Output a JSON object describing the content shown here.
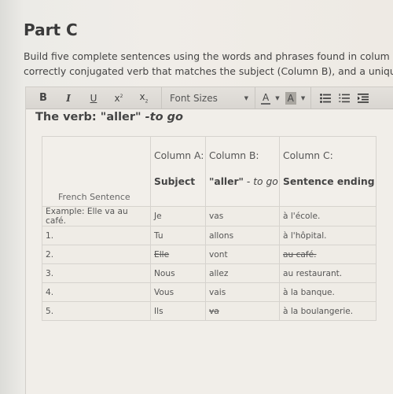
{
  "page": {
    "title": "Part C",
    "instructions_line1": "Build five complete sentences using the words and phrases found in colum",
    "instructions_line2": "correctly conjugated verb that matches the subject (Column B), and a uniqu"
  },
  "toolbar": {
    "bold": "B",
    "italic": "I",
    "underline": "U",
    "superscript_base": "x",
    "superscript_mark": "2",
    "subscript_base": "x",
    "subscript_mark": "2",
    "font_sizes_label": "Font Sizes",
    "text_color_label": "A",
    "bg_color_label": "A",
    "icons": [
      "bold-icon",
      "italic-icon",
      "underline-icon",
      "superscript-icon",
      "subscript-icon",
      "font-size-dropdown",
      "text-color-icon",
      "background-color-icon",
      "bulleted-list-icon",
      "numbered-list-icon",
      "indent-icon"
    ]
  },
  "editor": {
    "heading_main": "The verb: \"aller\" ",
    "heading_em": "-to go"
  },
  "table": {
    "header": {
      "col0_label": "French Sentence",
      "col1_top": "Column A:",
      "col1_sub": "Subject",
      "col2_top": "Column B:",
      "col2_sub_bold": "\"aller\"",
      "col2_sub_dash": " - ",
      "col2_sub_italic": "to go",
      "col3_top": "Column C:",
      "col3_sub": "Sentence ending"
    },
    "rows": [
      {
        "sentence": "Example: Elle va au café.",
        "subject": "Je",
        "verb": "vas",
        "ending": "à l'école.",
        "subject_struck": false,
        "verb_struck": false,
        "ending_struck": false
      },
      {
        "sentence": "1.",
        "subject": "Tu",
        "verb": "allons",
        "ending": "à l'hôpital.",
        "subject_struck": false,
        "verb_struck": false,
        "ending_struck": false
      },
      {
        "sentence": "2.",
        "subject": "Elle",
        "verb": "vont",
        "ending": "au café.",
        "subject_struck": true,
        "verb_struck": false,
        "ending_struck": true
      },
      {
        "sentence": "3.",
        "subject": "Nous",
        "verb": "allez",
        "ending": "au restaurant.",
        "subject_struck": false,
        "verb_struck": false,
        "ending_struck": false
      },
      {
        "sentence": "4.",
        "subject": "Vous",
        "verb": "vais",
        "ending": "à la banque.",
        "subject_struck": false,
        "verb_struck": false,
        "ending_struck": false
      },
      {
        "sentence": "5.",
        "subject": "Ils",
        "verb": "va",
        "ending": "à la boulangerie.",
        "subject_struck": false,
        "verb_struck": true,
        "ending_struck": false
      }
    ]
  }
}
